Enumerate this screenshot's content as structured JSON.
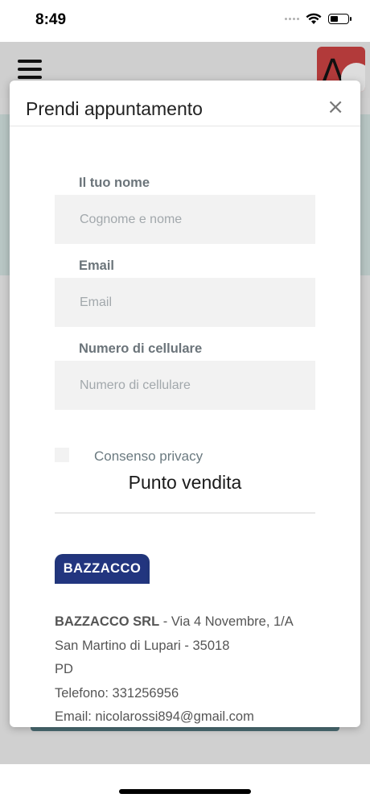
{
  "status_bar": {
    "time": "8:49",
    "battery_level": 0.45
  },
  "modal": {
    "title": "Prendi appuntamento",
    "close_label": "×"
  },
  "form": {
    "name": {
      "label": "Il tuo nome",
      "placeholder": "Cognome e nome",
      "value": ""
    },
    "email": {
      "label": "Email",
      "placeholder": "Email",
      "value": ""
    },
    "phone": {
      "label": "Numero di cellulare",
      "placeholder": "Numero di cellulare",
      "value": ""
    },
    "privacy_label": "Consenso privacy",
    "privacy_checked": false
  },
  "store": {
    "section_title": "Punto vendita",
    "logo_text": "BAZZACCO",
    "company": "BAZZACCO SRL",
    "address_rest": " - Via 4 Novembre, 1/A",
    "city_line": "San Martino di Lupari - 35018",
    "province": "PD",
    "phone_line": "Telefono: 331256956",
    "email_line": "Email: nicolarossi894@gmail.com"
  },
  "colors": {
    "brand_blue": "#21357a",
    "label_gray": "#6b747a",
    "input_bg": "#f2f2f2"
  }
}
